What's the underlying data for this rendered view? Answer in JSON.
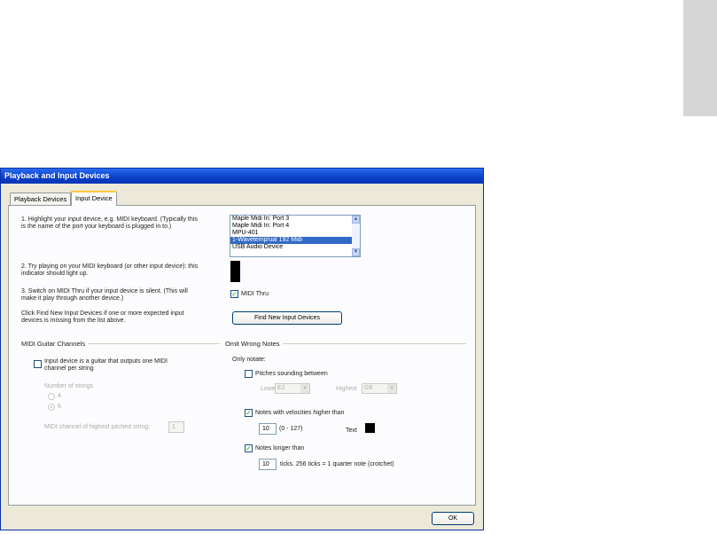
{
  "window": {
    "title": "Playback and Input Devices"
  },
  "tabs": [
    {
      "label": "Playback Devices",
      "active": false
    },
    {
      "label": "Input Device",
      "active": true
    }
  ],
  "input_device": {
    "step1_text_line1": "1. Highlight your input device, e.g. MIDI keyboard. (Typically this",
    "step1_text_line2": "is the name of the port your keyboard is plugged in to.)",
    "device_list": {
      "items": [
        "Maple Midi In: Port 3",
        "Maple Midi In: Port 4",
        "MPU-401",
        "1-Wavetemp/ual 192 Midi",
        "USB Audio Device"
      ],
      "selected": "1-Wavetemp/ual 192 Midi"
    },
    "step2_text_line1": "2. Try playing on your MIDI keyboard (or other input device): this",
    "step2_text_line2": "indicator should light up.",
    "step3_text_line1": "3. Switch on MIDI Thru if your input device is silent. (This will",
    "step3_text_line2": "make it play through another device.)",
    "midi_thru": {
      "label": "MIDI Thru",
      "checked": true
    },
    "find_text_line1": "Click Find New Input Devices if one or more expected input",
    "find_text_line2": "devices is missing from the list above.",
    "find_button_label": "Find New Input Devices"
  },
  "guitar": {
    "group_title": "MIDI Guitar Channels",
    "checkbox_label_line1": "Input device is a guitar that outputs one MIDI",
    "checkbox_label_line2": "channel per string",
    "checked": false,
    "strings_label": "Number of strings",
    "radio_options": [
      "4",
      "6"
    ],
    "radio_selected": "6",
    "channel_label": "MIDI channel of highest pitched string:",
    "channel_value": "1"
  },
  "omit": {
    "group_title": "Omit Wrong Notes",
    "only_notate": "Only notate:",
    "pitches_label": "Pitches sounding between",
    "pitches_checked": false,
    "lowest_label": "Lowest",
    "lowest_value": "E2",
    "highest_label": "Highest",
    "highest_value": "G6",
    "velocity_label": "Notes with velocities higher than",
    "velocity_checked": true,
    "velocity_value": "10",
    "velocity_range": "(0 - 127)",
    "text_label": "Text",
    "longer_label": "Notes longer than",
    "longer_checked": true,
    "longer_value": "10",
    "ticks_text": "ticks. 256 ticks = 1 quarter note (crotchet)"
  },
  "buttons": {
    "ok": "OK"
  },
  "colors": {
    "title_bar": "#0a3ec6",
    "dialog_bg": "#ece9d8",
    "selection": "#316ac5",
    "check": "#21a121"
  }
}
